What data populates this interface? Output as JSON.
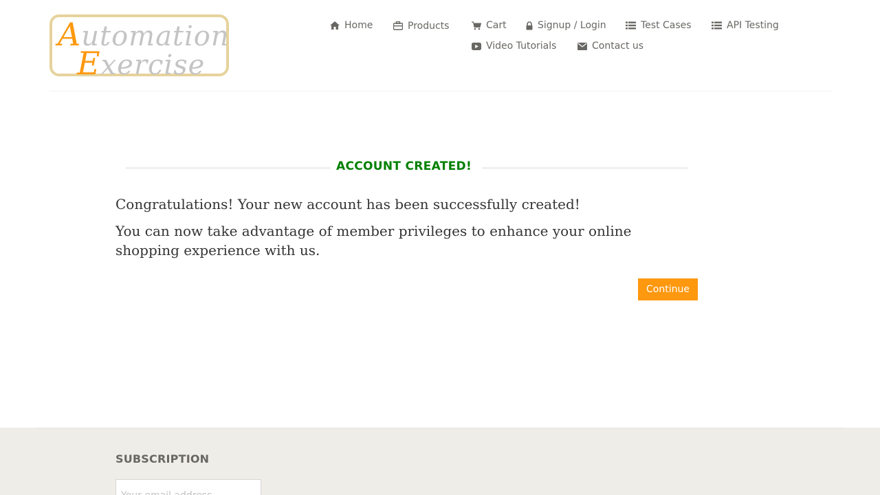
{
  "logo": {
    "line1_cap": "A",
    "line1_rest": "utomation",
    "line2_cap": "E",
    "line2_rest": "xercise"
  },
  "nav": {
    "home": "Home",
    "products": "Products",
    "cart": "Cart",
    "signup_login": "Signup / Login",
    "test_cases": "Test Cases",
    "api_testing": "API Testing",
    "video_tutorials": "Video Tutorials",
    "contact_us": "Contact us"
  },
  "account": {
    "title": "ACCOUNT CREATED!",
    "message1": "Congratulations! Your new account has been successfully created!",
    "message2": "You can now take advantage of member privileges to enhance your online shopping experience with us.",
    "continue_label": "Continue"
  },
  "footer": {
    "subscription_title": "SUBSCRIPTION",
    "email_placeholder": "Your email address"
  },
  "colors": {
    "accent": "#fe980f",
    "success": "#008000",
    "footer_bg": "#efede7"
  },
  "icons": {
    "home": "home-icon",
    "products": "briefcase-icon",
    "cart": "cart-icon",
    "signup_login": "lock-icon",
    "test_cases": "list-icon",
    "api_testing": "list-icon",
    "video_tutorials": "play-icon",
    "contact_us": "envelope-icon"
  }
}
